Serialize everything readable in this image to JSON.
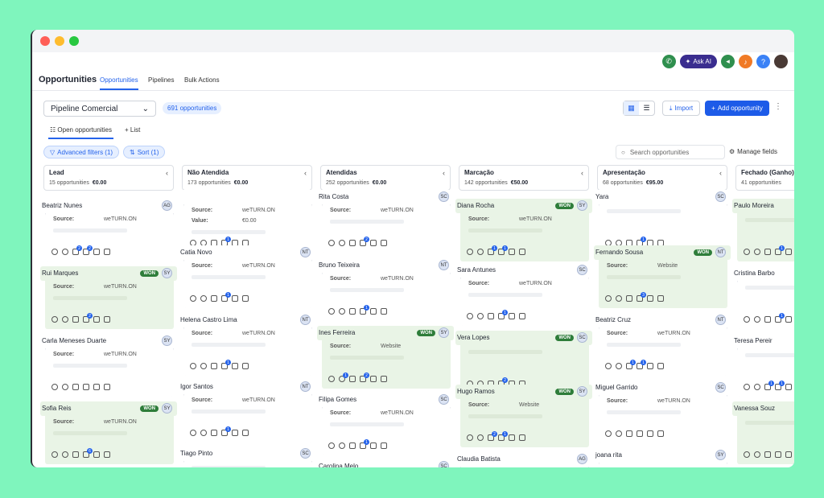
{
  "header": {
    "page_title": "Opportunities",
    "tabs": [
      "Opportunities",
      "Pipelines",
      "Bulk Actions"
    ],
    "ask_ai": "Ask AI"
  },
  "controls": {
    "pipeline": "Pipeline Comercial",
    "count": "691 opportunities",
    "import": "Import",
    "add": "Add opportunity"
  },
  "subtabs": {
    "open": "Open opportunities",
    "list": "List"
  },
  "filters": {
    "advanced": "Advanced filters (1)",
    "sort": "Sort (1)",
    "search_placeholder": "Search opportunities",
    "manage": "Manage fields"
  },
  "columns": [
    {
      "name": "Lead",
      "count": "15 opportunities",
      "value": "€0.00",
      "cards": [
        {
          "name": "Beatriz Nunes",
          "avatar": "AG",
          "won": false,
          "source": "weTURN.ON",
          "badges": [
            "",
            "",
            "2",
            "2",
            "",
            ""
          ]
        },
        {
          "name": "Rui Marques",
          "avatar": "SY",
          "won": true,
          "source": "weTURN.ON",
          "badges": [
            "",
            "",
            "",
            "2",
            "",
            ""
          ]
        },
        {
          "name": "Carla Meneses Duarte",
          "avatar": "SY",
          "won": false,
          "source": "weTURN.ON",
          "badges": [
            "",
            "",
            "",
            "",
            "",
            ""
          ]
        },
        {
          "name": "Sofia Reis",
          "avatar": "SY",
          "won": true,
          "source": "weTURN.ON",
          "badges": [
            "",
            "",
            "",
            "6",
            "",
            ""
          ]
        }
      ]
    },
    {
      "name": "Não Atendida",
      "count": "173 opportunities",
      "value": "€0.00",
      "cards": [
        {
          "name": "",
          "avatar": "",
          "won": false,
          "source": "weTURN.ON",
          "extra_label": "Value:",
          "extra_value": "€0.00",
          "badges": [
            "",
            "",
            "",
            "1",
            "",
            ""
          ]
        },
        {
          "name": "Catia Novo",
          "avatar": "NT",
          "won": false,
          "source": "weTURN.ON",
          "badges": [
            "",
            "",
            "",
            "1",
            "",
            ""
          ]
        },
        {
          "name": "Helena Castro Lima",
          "avatar": "NT",
          "won": false,
          "source": "weTURN.ON",
          "badges": [
            "",
            "",
            "",
            "1",
            "",
            ""
          ]
        },
        {
          "name": "Igor Santos",
          "avatar": "NT",
          "won": false,
          "source": "weTURN.ON",
          "badges": [
            "",
            "",
            "",
            "1",
            "",
            ""
          ]
        },
        {
          "name": "Tiago Pinto",
          "avatar": "SC",
          "won": false,
          "source": "",
          "badges": []
        }
      ]
    },
    {
      "name": "Atendidas",
      "count": "252 opportunities",
      "value": "€0.00",
      "cards": [
        {
          "name": "Rita Costa",
          "avatar": "SC",
          "won": false,
          "source": "weTURN.ON",
          "badges": [
            "",
            "",
            "",
            "2",
            "",
            ""
          ]
        },
        {
          "name": "Bruno Teixeira",
          "avatar": "NT",
          "won": false,
          "source": "weTURN.ON",
          "badges": [
            "",
            "",
            "",
            "1",
            "",
            ""
          ]
        },
        {
          "name": "Ines Ferreira",
          "avatar": "SY",
          "won": true,
          "source": "Website",
          "badges": [
            "",
            "1",
            "",
            "2",
            "",
            ""
          ]
        },
        {
          "name": "Filipa Gomes",
          "avatar": "SC",
          "won": false,
          "source": "weTURN.ON",
          "badges": [
            "",
            "",
            "",
            "1",
            "",
            ""
          ]
        },
        {
          "name": "Carolina Melo",
          "avatar": "SC",
          "won": false,
          "source": "",
          "badges": []
        }
      ]
    },
    {
      "name": "Marcação",
      "count": "142 opportunities",
      "value": "€50.00",
      "cards": [
        {
          "name": "Diana Rocha",
          "avatar": "SY",
          "won": true,
          "source": "weTURN.ON",
          "badges": [
            "",
            "",
            "1",
            "1",
            "",
            ""
          ]
        },
        {
          "name": "Sara Antunes",
          "avatar": "SC",
          "won": false,
          "source": "weTURN.ON",
          "badges": [
            "",
            "",
            "",
            "1",
            "",
            ""
          ]
        },
        {
          "name": "Vera Lopes",
          "avatar": "SC",
          "won": true,
          "source": "",
          "badges": [
            "",
            "",
            "",
            "2",
            "",
            ""
          ]
        },
        {
          "name": "Hugo Ramos",
          "avatar": "SY",
          "won": true,
          "source": "Website",
          "badges": [
            "",
            "",
            "2",
            "1",
            "",
            ""
          ]
        },
        {
          "name": "Claudia Batista",
          "avatar": "AG",
          "won": false,
          "source": "",
          "badges": []
        }
      ]
    },
    {
      "name": "Apresentação",
      "count": "68 opportunities",
      "value": "€95.00",
      "cards": [
        {
          "name": "Yara",
          "avatar": "SC",
          "won": false,
          "source": "",
          "badges": [
            "",
            "",
            "",
            "1",
            "",
            ""
          ]
        },
        {
          "name": "Fernando Sousa",
          "avatar": "NT",
          "won": true,
          "source": "Website",
          "badges": [
            "",
            "",
            "",
            "3",
            "",
            ""
          ]
        },
        {
          "name": "Beatriz Cruz",
          "avatar": "NT",
          "won": false,
          "source": "weTURN.ON",
          "badges": [
            "",
            "",
            "1",
            "1",
            "",
            ""
          ]
        },
        {
          "name": "Miguel Garrido",
          "avatar": "SC",
          "won": false,
          "source": "weTURN.ON",
          "badges": [
            "",
            "",
            "",
            "",
            "",
            ""
          ]
        },
        {
          "name": "joana rita",
          "avatar": "SY",
          "won": false,
          "source": "",
          "badges": []
        }
      ]
    },
    {
      "name": "Fechado (Ganho)",
      "count": "41 opportunities",
      "value": "",
      "cards": [
        {
          "name": "Paulo Moreira",
          "avatar": "",
          "won": true,
          "source": "",
          "badges": [
            "",
            "",
            "",
            "1",
            "",
            ""
          ]
        },
        {
          "name": "Cristina Barbo",
          "avatar": "",
          "won": false,
          "source": "",
          "badges": [
            "",
            "",
            "",
            "1",
            "",
            ""
          ]
        },
        {
          "name": "Teresa Pereir",
          "avatar": "",
          "won": false,
          "source": "",
          "badges": [
            "",
            "",
            "1",
            "1",
            "",
            ""
          ]
        },
        {
          "name": "Vanessa Souz",
          "avatar": "",
          "won": true,
          "source": "",
          "badges": [
            "",
            "",
            "",
            "",
            "",
            ""
          ]
        }
      ]
    }
  ],
  "labels": {
    "source": "Source:"
  }
}
